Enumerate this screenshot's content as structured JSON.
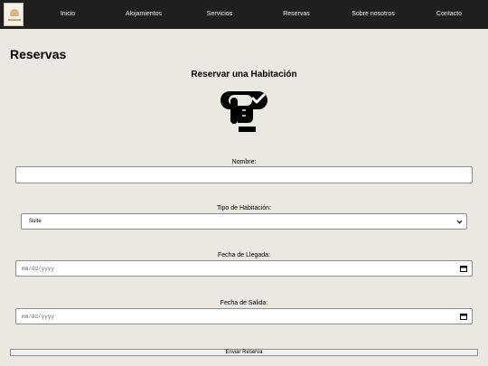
{
  "nav": {
    "logo_icon": "hotel-logo-icon",
    "links": [
      "Inicio",
      "Alojamientos",
      "Servicios",
      "Reservas",
      "Sobre nosotros",
      "Contacto"
    ]
  },
  "page": {
    "title": "Reservas"
  },
  "section": {
    "title": "Reservar una Habitación",
    "icon": "hand-check-icon"
  },
  "form": {
    "name_label": "Nombre:",
    "name_value": "",
    "room_type_label": "Tipo de Habitación:",
    "room_type_value": "Suite",
    "arrival_label": "Fecha de Llegada:",
    "arrival_placeholder": "mm/dd/yyyy",
    "departure_label": "Fecha de Salida:",
    "departure_placeholder": "mm/dd/yyyy",
    "submit_label": "Enviar Reserva"
  },
  "colors": {
    "navbar": "#1f1f1f",
    "background": "#ebe7e1"
  }
}
